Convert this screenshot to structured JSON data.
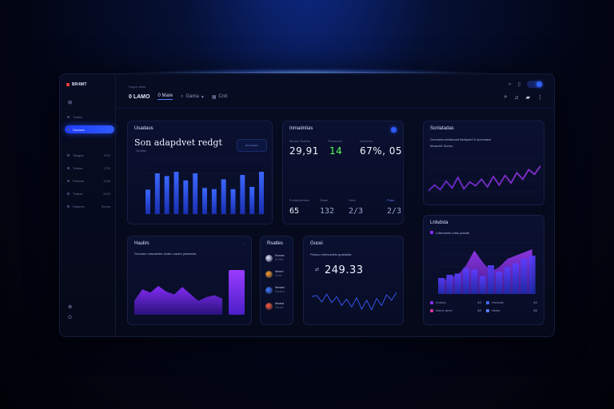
{
  "app": {
    "brand": "BR4MT",
    "crumb": "Sopos ribist"
  },
  "header": {
    "tabs": [
      {
        "label": "0 LAMO"
      },
      {
        "label": "0 Mare"
      },
      {
        "label": "Gama"
      },
      {
        "label": "Cnit"
      }
    ]
  },
  "sidebar": {
    "items": [
      {
        "label": "Tottas",
        "count": ""
      },
      {
        "label": "Seahas",
        "count": ""
      },
      {
        "label": "Tasgss",
        "count": "KSS"
      },
      {
        "label": "Totsss",
        "count": "CS0"
      },
      {
        "label": "Pesses",
        "count": "1255"
      },
      {
        "label": "Tiasss",
        "count": "4120"
      },
      {
        "label": "Sissers",
        "count": "Seeas"
      }
    ],
    "active_index": 1
  },
  "colors": {
    "accent": "#2f5bff",
    "purple": "#8a2cff",
    "green": "#4dff4d"
  },
  "card_main": {
    "title": "Usadaus",
    "headline": "Son adapdvet redgt",
    "sub": "Scntise",
    "badge": "Hnnt Sesen",
    "chart_data": {
      "type": "bar",
      "values": [
        45,
        75,
        70,
        78,
        62,
        75,
        48,
        46,
        64,
        46,
        72,
        50,
        78
      ],
      "ylim": [
        0,
        100
      ]
    }
  },
  "card_stats": {
    "title": "Inmadntias",
    "labels": [
      "Mmadr Ridesa",
      "Pesmnine",
      "Hcuerers"
    ],
    "values": [
      "29,91",
      "14",
      "67%, 05"
    ],
    "sub_labels": [
      "Fumpsdeness",
      "Stsae",
      "Hnra",
      "Poes"
    ],
    "sub_values": [
      "65",
      "132",
      "2/3",
      "2/3"
    ]
  },
  "card_line1": {
    "title": "Scnlatadas",
    "desc1": "Doovsistuonsfapsad fiadkpard 6 opecstaxe",
    "desc2": "Moarcnit  Sorisa",
    "chart_data": {
      "type": "line",
      "values": [
        15,
        30,
        18,
        40,
        22,
        50,
        20,
        38,
        28,
        45,
        25,
        52,
        30,
        55,
        35,
        62,
        45,
        70,
        58,
        80
      ]
    }
  },
  "card_area": {
    "title": "Haulirs",
    "sub": "Sexcaes mrtadsebe strabu caotrs pleseeiss",
    "chart_data": {
      "type": "area",
      "values": [
        30,
        55,
        48,
        62,
        50,
        44,
        60,
        45,
        30,
        38,
        42,
        35
      ]
    }
  },
  "card_list": {
    "title": "Rsatles",
    "items": [
      {
        "label": "Eonses",
        "sub": "Nt 256"
      },
      {
        "label": "Nmerd",
        "sub": "Hnde"
      },
      {
        "label": "Nmvtes",
        "sub": "Dandss"
      },
      {
        "label": "Nmavd",
        "sub": "Hande"
      }
    ]
  },
  "card_value": {
    "title": "Gucei",
    "sub": "Psdrso ebetvdelets gutetadis",
    "value": "249.33",
    "chart_data": {
      "type": "line",
      "values": [
        55,
        58,
        40,
        62,
        38,
        55,
        30,
        48,
        26,
        52,
        20,
        45,
        18,
        50,
        30,
        60,
        45,
        66
      ]
    }
  },
  "card_combo": {
    "title": "Lnlsdsta",
    "sub": "Lnllesdmts ndds pasdte",
    "legend": [
      {
        "label": "Dvesrs",
        "value": "$3"
      },
      {
        "label": "Hnesdte",
        "value": "$3"
      },
      {
        "label": "Nmoe aene",
        "value": "$5"
      },
      {
        "label": "Neste",
        "value": "$5"
      }
    ],
    "chart_data": {
      "type": "bar",
      "values": [
        25,
        30,
        32,
        40,
        38,
        28,
        45,
        35,
        42,
        48,
        55,
        60
      ],
      "line": [
        20,
        26,
        30,
        45,
        68,
        50,
        35,
        42,
        55,
        60,
        65,
        70
      ]
    }
  }
}
